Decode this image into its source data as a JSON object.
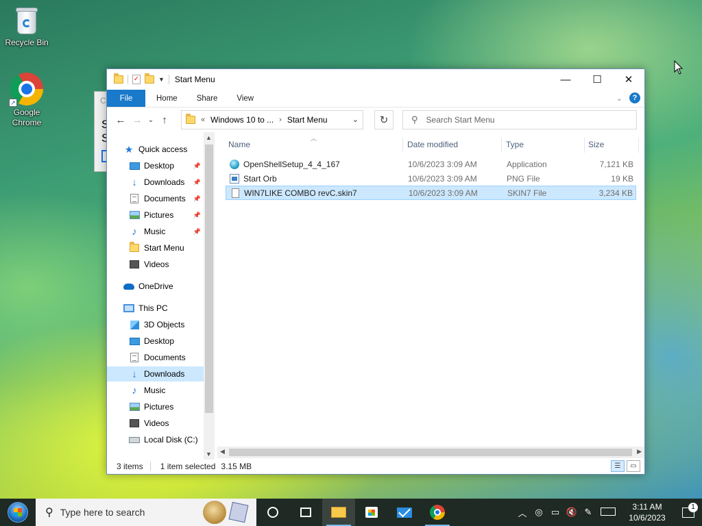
{
  "desktop": {
    "icons": [
      {
        "label": "Recycle Bin",
        "icon": "recycle-bin-icon"
      },
      {
        "label": "Google Chrome",
        "icon": "chrome-icon"
      }
    ]
  },
  "background_dialog": {
    "title_char": "C",
    "text_line1": "S",
    "text_line2": "S"
  },
  "window": {
    "title": "Start Menu",
    "ribbon_tabs": [
      "File",
      "Home",
      "Share",
      "View"
    ],
    "help_glyph": "?",
    "address": {
      "crumb_overflow": "«",
      "crumb1": "Windows 10 to ...",
      "crumb2": "Start Menu"
    },
    "search_placeholder": "Search Start Menu",
    "nav": {
      "quick_access": "Quick access",
      "qa_items": [
        "Desktop",
        "Downloads",
        "Documents",
        "Pictures",
        "Music",
        "Start Menu",
        "Videos"
      ],
      "onedrive": "OneDrive",
      "this_pc": "This PC",
      "pc_items": [
        "3D Objects",
        "Desktop",
        "Documents",
        "Downloads",
        "Music",
        "Pictures",
        "Videos",
        "Local Disk (C:)"
      ],
      "selected": "Downloads"
    },
    "columns": {
      "name": "Name",
      "date": "Date modified",
      "type": "Type",
      "size": "Size"
    },
    "files": [
      {
        "name": "OpenShellSetup_4_4_167",
        "date": "10/6/2023 3:09 AM",
        "type": "Application",
        "size": "7,121 KB",
        "icon": "application-icon"
      },
      {
        "name": "Start Orb",
        "date": "10/6/2023 3:09 AM",
        "type": "PNG File",
        "size": "19 KB",
        "icon": "png-file-icon"
      },
      {
        "name": "WIN7LIKE COMBO revC.skin7",
        "date": "10/6/2023 3:09 AM",
        "type": "SKIN7 File",
        "size": "3,234 KB",
        "icon": "generic-file-icon",
        "selected": true
      }
    ],
    "status": {
      "items": "3 items",
      "selected": "1 item selected",
      "size": "3.15 MB"
    }
  },
  "taskbar": {
    "search_placeholder": "Type here to search",
    "clock_time": "3:11 AM",
    "clock_date": "10/6/2023",
    "notification_count": "1"
  },
  "colors": {
    "accent": "#1979ca",
    "selection": "#cce8ff",
    "taskbar": "#1f2a24"
  }
}
